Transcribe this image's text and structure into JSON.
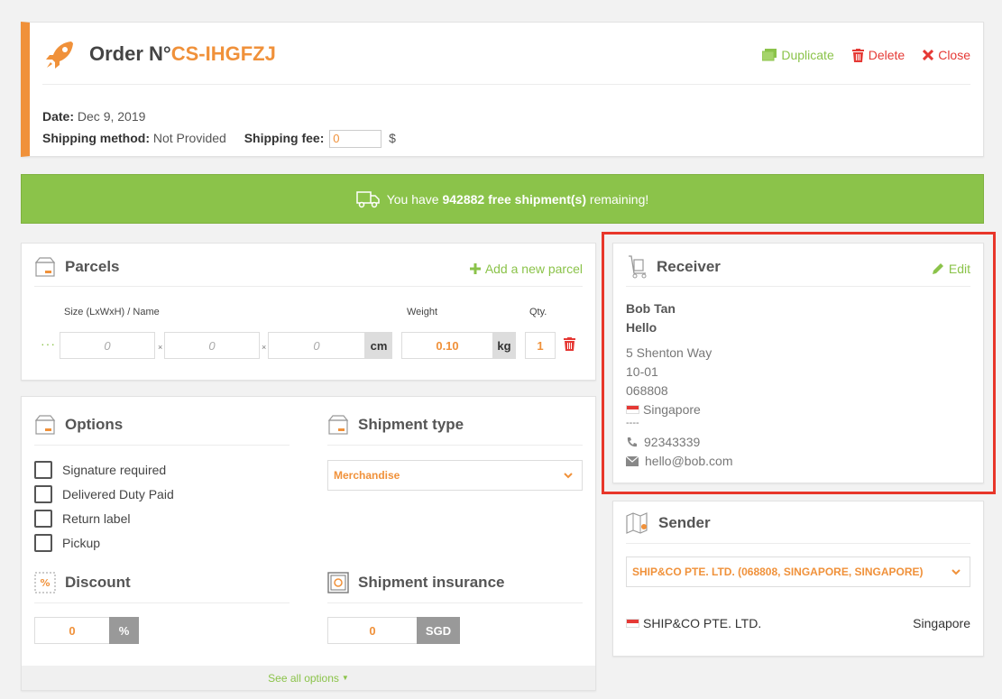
{
  "order": {
    "title_prefix": "Order N°",
    "number": "CS-IHGFZJ",
    "date_label": "Date:",
    "date_value": "Dec 9, 2019",
    "shipping_method_label": "Shipping method:",
    "shipping_method_value": "Not Provided",
    "shipping_fee_label": "Shipping fee:",
    "shipping_fee_value": "0",
    "currency_symbol": "$",
    "actions": {
      "duplicate": "Duplicate",
      "delete": "Delete",
      "close": "Close"
    }
  },
  "banner": {
    "text_before": "You have ",
    "count_text": "942882 free shipment(s)",
    "text_after": " remaining!"
  },
  "parcels": {
    "title": "Parcels",
    "add_label": "Add a new parcel",
    "col_size": "Size (LxWxH) / Name",
    "col_weight": "Weight",
    "col_qty": "Qty.",
    "drag_handle": "···",
    "times": "×",
    "length": "0",
    "width": "0",
    "height": "0",
    "dim_unit": "cm",
    "weight": "0.10",
    "weight_unit": "kg",
    "qty": "1"
  },
  "options": {
    "title": "Options",
    "items": [
      "Signature required",
      "Delivered Duty Paid",
      "Return label",
      "Pickup"
    ],
    "shipment_type_title": "Shipment type",
    "shipment_type_value": "Merchandise",
    "discount_title": "Discount",
    "discount_value": "0",
    "discount_unit": "%",
    "insurance_title": "Shipment insurance",
    "insurance_value": "0",
    "insurance_unit": "SGD",
    "see_all": "See all options"
  },
  "receiver": {
    "title": "Receiver",
    "edit_label": "Edit",
    "name": "Bob Tan",
    "company": "Hello",
    "address1": "5 Shenton Way",
    "address2": "10-01",
    "postal": "068808",
    "country": "Singapore",
    "separator": "----",
    "phone": "92343339",
    "email": "hello@bob.com"
  },
  "sender": {
    "title": "Sender",
    "select_value": "SHIP&CO PTE. LTD. (068808, SINGAPORE, SINGAPORE)",
    "company": "SHIP&CO PTE. LTD.",
    "country": "Singapore"
  },
  "colors": {
    "accent_orange": "#f0913a",
    "accent_green": "#8bc34a",
    "danger_red": "#e53935",
    "highlight_red": "#e8362a"
  }
}
